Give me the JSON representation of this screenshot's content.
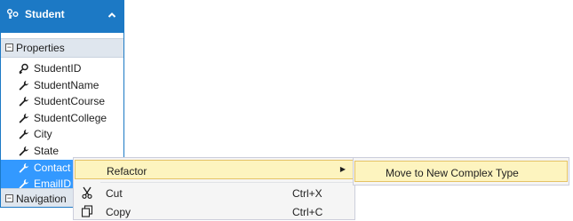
{
  "entity": {
    "title": "Student",
    "sections": {
      "properties": "Properties",
      "navigation": "Navigation"
    },
    "properties": [
      {
        "label": "StudentID",
        "icon": "key-icon",
        "selected": false
      },
      {
        "label": "StudentName",
        "icon": "wrench-icon",
        "selected": false
      },
      {
        "label": "StudentCourse",
        "icon": "wrench-icon",
        "selected": false
      },
      {
        "label": "StudentCollege",
        "icon": "wrench-icon",
        "selected": false
      },
      {
        "label": "City",
        "icon": "wrench-icon",
        "selected": false
      },
      {
        "label": "State",
        "icon": "wrench-icon",
        "selected": false
      },
      {
        "label": "Contact",
        "icon": "wrench-icon",
        "selected": true
      },
      {
        "label": "EmailID",
        "icon": "wrench-icon",
        "selected": true
      }
    ]
  },
  "context_menu": {
    "items": [
      {
        "label": "Refactor",
        "shortcut": "",
        "has_submenu": true
      },
      {
        "label": "Cut",
        "shortcut": "Ctrl+X",
        "icon": "scissors-icon"
      },
      {
        "label": "Copy",
        "shortcut": "Ctrl+C",
        "icon": "copy-icon"
      }
    ]
  },
  "submenu": {
    "items": [
      {
        "label": "Move to New Complex Type"
      }
    ]
  },
  "colors": {
    "header": "#1c79c5",
    "selection": "#3399ff",
    "menu_highlight": "#fdf4bf"
  }
}
